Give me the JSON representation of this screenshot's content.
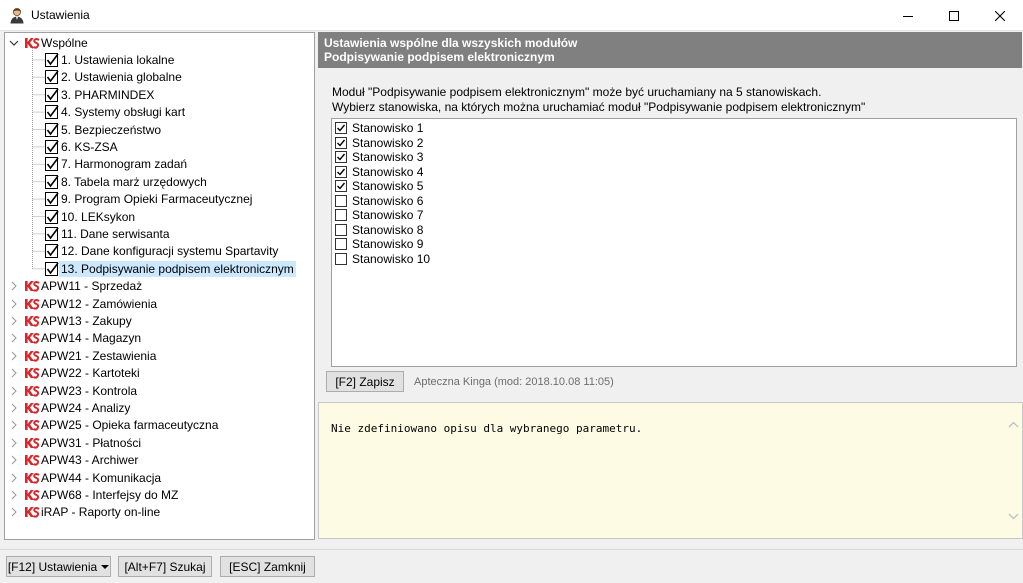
{
  "window": {
    "title": "Ustawienia"
  },
  "tree": {
    "root": "Wspólne",
    "children": [
      "1. Ustawienia lokalne",
      "2. Ustawienia globalne",
      "3. PHARMINDEX",
      "4. Systemy obsługi kart",
      "5. Bezpieczeństwo",
      "6. KS-ZSA",
      "7. Harmonogram zadań",
      "8. Tabela marż urzędowych",
      "9. Program Opieki Farmaceutycznej",
      "10. LEKsykon",
      "11. Dane serwisanta",
      "12. Dane konfiguracji systemu Spartavity",
      "13. Podpisywanie podpisem elektronicznym"
    ],
    "selected_index": 12,
    "modules": [
      "APW11 - Sprzedaż",
      "APW12 - Zamówienia",
      "APW13 - Zakupy",
      "APW14 - Magazyn",
      "APW21 - Zestawienia",
      "APW22 - Kartoteki",
      "APW23 - Kontrola",
      "APW24 - Analizy",
      "APW25 - Opieka farmaceutyczna",
      "APW31 - Płatności",
      "APW43 - Archiwer",
      "APW44 - Komunikacja",
      "APW68 - Interfejsy do MZ",
      "iRAP - Raporty on-line"
    ]
  },
  "panel": {
    "header_line1": "Ustawienia wspólne dla wszyskich modułów",
    "header_line2": "Podpisywanie podpisem elektronicznym",
    "info_line1": "Moduł \"Podpisywanie podpisem elektronicznym\" może być uruchamiany na 5 stanowiskach.",
    "info_line2": "Wybierz stanowiska, na których można uruchamiać moduł \"Podpisywanie podpisem elektronicznym\"",
    "stations": [
      {
        "label": "Stanowisko 1",
        "checked": true
      },
      {
        "label": "Stanowisko 2",
        "checked": true
      },
      {
        "label": "Stanowisko 3",
        "checked": true
      },
      {
        "label": "Stanowisko 4",
        "checked": true
      },
      {
        "label": "Stanowisko 5",
        "checked": true
      },
      {
        "label": "Stanowisko 6",
        "checked": false
      },
      {
        "label": "Stanowisko 7",
        "checked": false
      },
      {
        "label": "Stanowisko 8",
        "checked": false
      },
      {
        "label": "Stanowisko 9",
        "checked": false
      },
      {
        "label": "Stanowisko 10",
        "checked": false
      }
    ],
    "save_label": "[F2] Zapisz",
    "mod_info": "Apteczna Kinga (mod: 2018.10.08 11:05)",
    "description": "Nie zdefiniowano opisu dla wybranego parametru."
  },
  "bottom": {
    "settings_label": "[F12] Ustawienia",
    "search_label": "[Alt+F7] Szukaj",
    "close_label": "[ESC] Zamknij"
  },
  "colors": {
    "header_bg": "#808080",
    "selection": "#cce8ff",
    "description_bg": "#fefbe5",
    "ks_red": "#d9262b"
  }
}
